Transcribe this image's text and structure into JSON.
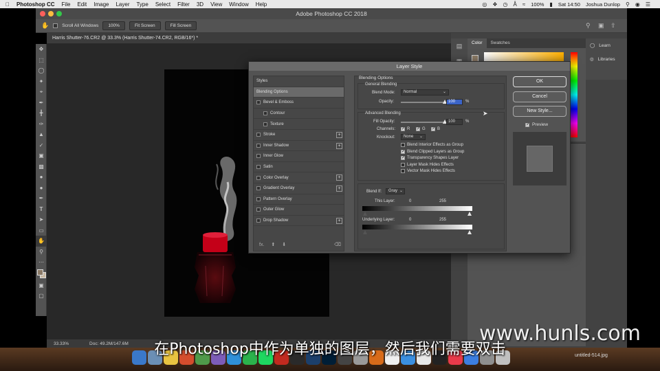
{
  "menubar": {
    "apple": "",
    "app": "Photoshop CC",
    "items": [
      "File",
      "Edit",
      "Image",
      "Layer",
      "Type",
      "Select",
      "Filter",
      "3D",
      "View",
      "Window",
      "Help"
    ],
    "battery": "100%",
    "clock": "Sat 14:50",
    "user": "Joshua Dunlop"
  },
  "window": {
    "title": "Adobe Photoshop CC 2018"
  },
  "options_bar": {
    "scroll_all": "Scroll All Windows",
    "zoom_100": "100%",
    "fit_screen": "Fit Screen",
    "fill_screen": "Fill Screen"
  },
  "document": {
    "tab": "Harris Shutter-76.CR2 @ 33.3% (Harris Shutter-74.CR2, RGB/16*) *",
    "zoom": "33.33%",
    "doc_size": "Doc: 49.2M/147.6M"
  },
  "panels": {
    "color_tab": "Color",
    "swatches_tab": "Swatches",
    "learn": "Learn",
    "libraries": "Libraries"
  },
  "dialog": {
    "title": "Layer Style",
    "styles_header": "Styles",
    "style_items": [
      {
        "label": "Blending Options",
        "checkbox": false,
        "indent": false,
        "plus": false,
        "selected": true
      },
      {
        "label": "Bevel & Emboss",
        "checkbox": true,
        "indent": false,
        "plus": false,
        "selected": false
      },
      {
        "label": "Contour",
        "checkbox": true,
        "indent": true,
        "plus": false,
        "selected": false
      },
      {
        "label": "Texture",
        "checkbox": true,
        "indent": true,
        "plus": false,
        "selected": false
      },
      {
        "label": "Stroke",
        "checkbox": true,
        "indent": false,
        "plus": true,
        "selected": false
      },
      {
        "label": "Inner Shadow",
        "checkbox": true,
        "indent": false,
        "plus": true,
        "selected": false
      },
      {
        "label": "Inner Glow",
        "checkbox": true,
        "indent": false,
        "plus": false,
        "selected": false
      },
      {
        "label": "Satin",
        "checkbox": true,
        "indent": false,
        "plus": false,
        "selected": false
      },
      {
        "label": "Color Overlay",
        "checkbox": true,
        "indent": false,
        "plus": true,
        "selected": false
      },
      {
        "label": "Gradient Overlay",
        "checkbox": true,
        "indent": false,
        "plus": true,
        "selected": false
      },
      {
        "label": "Pattern Overlay",
        "checkbox": true,
        "indent": false,
        "plus": false,
        "selected": false
      },
      {
        "label": "Outer Glow",
        "checkbox": true,
        "indent": false,
        "plus": false,
        "selected": false
      },
      {
        "label": "Drop Shadow",
        "checkbox": true,
        "indent": false,
        "plus": true,
        "selected": false
      }
    ],
    "footer_fx": "fx.",
    "blending_options": "Blending Options",
    "general_blending": "General Blending",
    "blend_mode_label": "Blend Mode:",
    "blend_mode_value": "Normal",
    "opacity_label": "Opacity:",
    "opacity_value": "100",
    "opacity_level": 1.0,
    "percent": "%",
    "advanced_blending": "Advanced Blending",
    "fill_opacity_label": "Fill Opacity:",
    "fill_opacity_value": "100",
    "fill_opacity_level": 1.0,
    "channels_label": "Channels:",
    "channels": [
      {
        "label": "R",
        "checked": true
      },
      {
        "label": "G",
        "checked": true
      },
      {
        "label": "B",
        "checked": true
      }
    ],
    "knockout_label": "Knockout:",
    "knockout_value": "None",
    "advanced_options": [
      {
        "label": "Blend Interior Effects as Group",
        "checked": false
      },
      {
        "label": "Blend Clipped Layers as Group",
        "checked": true
      },
      {
        "label": "Transparency Shapes Layer",
        "checked": true
      },
      {
        "label": "Layer Mask Hides Effects",
        "checked": false
      },
      {
        "label": "Vector Mask Hides Effects",
        "checked": false
      }
    ],
    "blend_if_label": "Blend If:",
    "blend_if_value": "Gray",
    "this_layer_label": "This Layer:",
    "underlying_layer_label": "Underlying Layer:",
    "range_min": "0",
    "range_max": "255",
    "ok": "OK",
    "cancel": "Cancel",
    "new_style": "New Style...",
    "preview": "Preview",
    "preview_checked": true
  },
  "subtitle": "在Photoshop中作为单独的图层，然后我们需要双击",
  "watermark": "www.hunls.com",
  "desktop_file": "untitled-514.jpg",
  "colors": {
    "traffic": [
      "#fc605c",
      "#fdbc40",
      "#34c84a"
    ],
    "candle_red": "#c40018",
    "dock_icons": [
      "#3a78c9",
      "#6b8fb5",
      "#e8c341",
      "#d44d2d",
      "#4f9a4a",
      "#7d5cb8",
      "#2f90d8",
      "#2bb24c",
      "#1ed760",
      "#c22a1f",
      "#2a2a2a",
      "#1c3f6b",
      "#001e36",
      "#444",
      "#9a9a9a",
      "#d86b1a",
      "#f0f0f0",
      "#3b8fe0",
      "#e8e8e8",
      "#222",
      "#e83a4a",
      "#3c7ee0",
      "#8f8f8f",
      "#c0c0c0"
    ]
  }
}
